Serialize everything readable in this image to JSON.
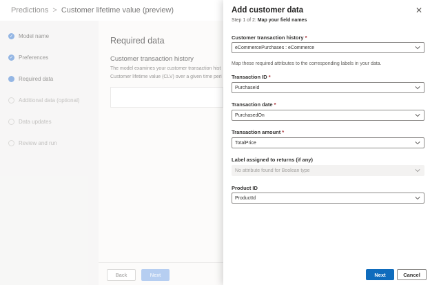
{
  "breadcrumb": {
    "root": "Predictions",
    "separator": ">",
    "current": "Customer lifetime value (preview)"
  },
  "steps": [
    {
      "label": "Model name",
      "state": "done"
    },
    {
      "label": "Preferences",
      "state": "done"
    },
    {
      "label": "Required data",
      "state": "current"
    },
    {
      "label": "Additional data (optional)",
      "state": "todo"
    },
    {
      "label": "Data updates",
      "state": "todo"
    },
    {
      "label": "Review and run",
      "state": "todo"
    }
  ],
  "main": {
    "title": "Required data",
    "section_title": "Customer transaction history",
    "desc_line1": "The model examines your customer transaction hist",
    "desc_line2": "Customer lifetime value (CLV) over a given time peri"
  },
  "footer": {
    "back": "Back",
    "next": "Next"
  },
  "panel": {
    "title": "Add customer data",
    "step_prefix": "Step 1 of 2:",
    "step_name": "Map your field names",
    "fields": {
      "history": {
        "label": "Customer transaction history",
        "value": "eCommercePurchases : eCommerce"
      },
      "hint": "Map these required attributes to the corresponding labels in your data.",
      "transaction_id": {
        "label": "Transaction ID",
        "value": "PurchaseId"
      },
      "transaction_date": {
        "label": "Transaction date",
        "value": "PurchasedOn"
      },
      "transaction_amount": {
        "label": "Transaction amount",
        "value": "TotalPrice"
      },
      "returns": {
        "label": "Label assigned to returns (if any)",
        "value": "No attribute found for Boolean type"
      },
      "product_id": {
        "label": "Product ID",
        "value": "ProductId"
      }
    },
    "required_mark": "*",
    "next": "Next",
    "cancel": "Cancel"
  },
  "colors": {
    "accent": "#0f6cbd",
    "required": "#a4262c",
    "step_done": "#5b8fd6"
  }
}
